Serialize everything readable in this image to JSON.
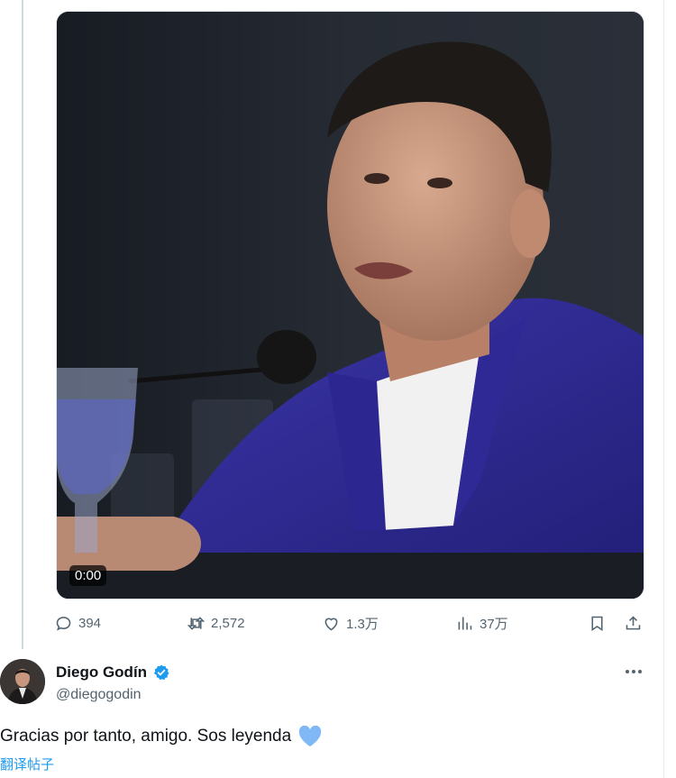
{
  "video": {
    "timestamp": "0:00"
  },
  "actions": {
    "replies": "394",
    "reposts": "2,572",
    "likes": "1.3万",
    "views": "37万"
  },
  "reply": {
    "display_name": "Diego Godín",
    "handle": "@diegogodin",
    "text": "Gracias por tanto, amigo. Sos leyenda",
    "translate_label": "翻译帖子"
  },
  "colors": {
    "accent": "#1d9bf0",
    "muted": "#536471",
    "heart_emoji": "#7fb8f5"
  },
  "icons": [
    "reply-icon",
    "repost-icon",
    "like-icon",
    "views-icon",
    "bookmark-icon",
    "share-icon",
    "verified-badge-icon",
    "more-icon",
    "blue-heart-emoji"
  ]
}
